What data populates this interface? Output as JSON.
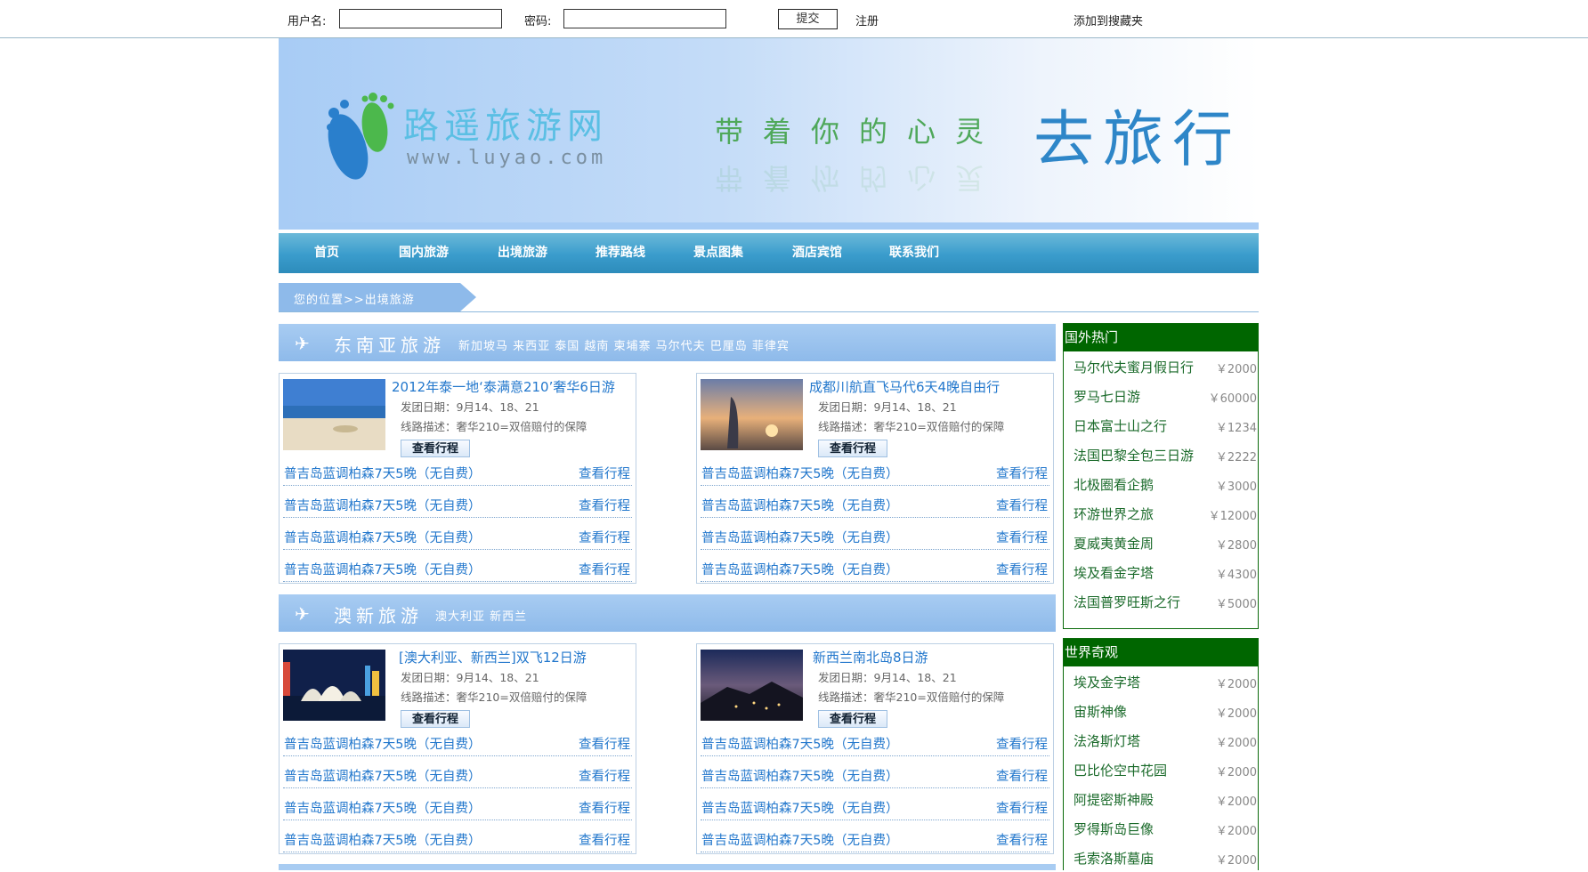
{
  "topbar": {
    "username_label": "用户名:",
    "username_value": "",
    "password_label": "密码:",
    "password_value": "",
    "submit_label": "提交",
    "register_label": "注册",
    "favorite_label": "添加到搜藏夹"
  },
  "banner": {
    "site_name": "路遥旅游网",
    "site_url": "www.luyao.com",
    "slogan_small": "带着你的心灵",
    "slogan_big": "去旅行"
  },
  "nav": [
    "首页",
    "国内旅游",
    "出境旅游",
    "推荐路线",
    "景点图集",
    "酒店宾馆",
    "联系我们"
  ],
  "breadcrumb": "您的位置>>出境旅游",
  "sections": [
    {
      "title": "东南亚旅游",
      "tags": "新加坡马  来西亚  泰国  越南  柬埔寨  马尔代夫  巴厘岛  菲律宾",
      "boxes": [
        {
          "title": "2012年泰一地‘泰满意210’奢华6日游",
          "date_label": "发团日期：9月14、18、21",
          "desc_label": "线路描述：奢华210=双倍赔付的保障",
          "detail_label": "查看行程",
          "rows": [
            {
              "name": "普吉岛蓝调柏森7天5晚（无自费）",
              "link": "查看行程"
            },
            {
              "name": "普吉岛蓝调柏森7天5晚（无自费）",
              "link": "查看行程"
            },
            {
              "name": "普吉岛蓝调柏森7天5晚（无自费）",
              "link": "查看行程"
            },
            {
              "name": "普吉岛蓝调柏森7天5晚（无自费）",
              "link": "查看行程"
            }
          ]
        },
        {
          "title": "成都川航直飞马代6天4晚自由行",
          "date_label": "发团日期：9月14、18、21",
          "desc_label": "线路描述：奢华210=双倍赔付的保障",
          "detail_label": "查看行程",
          "rows": [
            {
              "name": "普吉岛蓝调柏森7天5晚（无自费）",
              "link": "查看行程"
            },
            {
              "name": "普吉岛蓝调柏森7天5晚（无自费）",
              "link": "查看行程"
            },
            {
              "name": "普吉岛蓝调柏森7天5晚（无自费）",
              "link": "查看行程"
            },
            {
              "name": "普吉岛蓝调柏森7天5晚（无自费）",
              "link": "查看行程"
            }
          ]
        }
      ]
    },
    {
      "title": "澳新旅游",
      "tags": "澳大利亚  新西兰",
      "boxes": [
        {
          "title": "[澳大利亚、新西兰]双飞12日游",
          "date_label": "发团日期：9月14、18、21",
          "desc_label": "线路描述：奢华210=双倍赔付的保障",
          "detail_label": "查看行程",
          "rows": [
            {
              "name": "普吉岛蓝调柏森7天5晚（无自费）",
              "link": "查看行程"
            },
            {
              "name": "普吉岛蓝调柏森7天5晚（无自费）",
              "link": "查看行程"
            },
            {
              "name": "普吉岛蓝调柏森7天5晚（无自费）",
              "link": "查看行程"
            },
            {
              "name": "普吉岛蓝调柏森7天5晚（无自费）",
              "link": "查看行程"
            }
          ]
        },
        {
          "title": "新西兰南北岛8日游",
          "date_label": "发团日期：9月14、18、21",
          "desc_label": "线路描述：奢华210=双倍赔付的保障",
          "detail_label": "查看行程",
          "rows": [
            {
              "name": "普吉岛蓝调柏森7天5晚（无自费）",
              "link": "查看行程"
            },
            {
              "name": "普吉岛蓝调柏森7天5晚（无自费）",
              "link": "查看行程"
            },
            {
              "name": "普吉岛蓝调柏森7天5晚（无自费）",
              "link": "查看行程"
            },
            {
              "name": "普吉岛蓝调柏森7天5晚（无自费）",
              "link": "查看行程"
            }
          ]
        }
      ]
    }
  ],
  "sidebar": [
    {
      "title": "国外热门",
      "items": [
        {
          "name": "马尔代夫蜜月假日行",
          "price": "￥2000"
        },
        {
          "name": "罗马七日游",
          "price": "￥60000"
        },
        {
          "name": "日本富士山之行",
          "price": "￥1234"
        },
        {
          "name": "法国巴黎全包三日游",
          "price": "￥2222"
        },
        {
          "name": "北极圈看企鹅",
          "price": "￥3000"
        },
        {
          "name": "环游世界之旅",
          "price": "￥12000"
        },
        {
          "name": "夏威夷黄金周",
          "price": "￥2800"
        },
        {
          "name": "埃及看金字塔",
          "price": "￥4300"
        },
        {
          "name": "法国普罗旺斯之行",
          "price": "￥5000"
        }
      ]
    },
    {
      "title": "世界奇观",
      "items": [
        {
          "name": "埃及金字塔",
          "price": "￥2000"
        },
        {
          "name": "宙斯神像",
          "price": "￥2000"
        },
        {
          "name": "法洛斯灯塔",
          "price": "￥2000"
        },
        {
          "name": "巴比伦空中花园",
          "price": "￥2000"
        },
        {
          "name": "阿提密斯神殿",
          "price": "￥2000"
        },
        {
          "name": "罗得斯岛巨像",
          "price": "￥2000"
        },
        {
          "name": "毛索洛斯墓庙",
          "price": "￥2000"
        }
      ]
    }
  ],
  "colors": {
    "nav_blue": "#3a9ccc",
    "link_blue": "#2277cc",
    "side_green": "#006600",
    "side_text_green": "#1a6a2a"
  }
}
